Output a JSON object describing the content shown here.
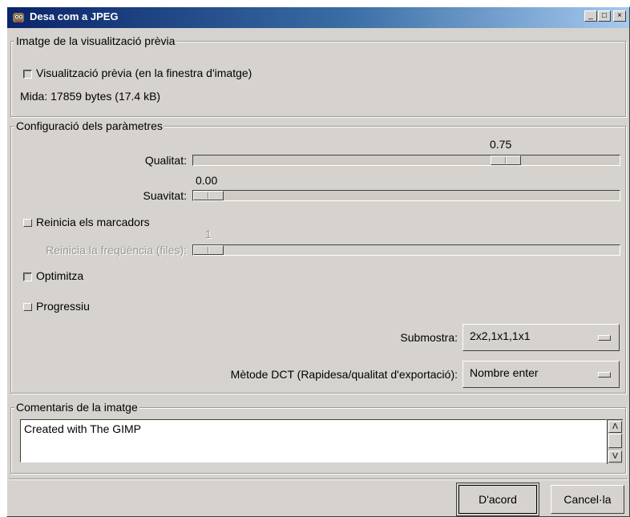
{
  "window": {
    "title": "Desa com a JPEG",
    "controls": {
      "minimize": "_",
      "maximize": "□",
      "close": "×"
    }
  },
  "preview_frame": {
    "title": "Imatge de la visualització prèvia",
    "preview_checkbox_label": "Visualització prèvia (en la finestra d'imatge)",
    "preview_checked": false,
    "size_text": "Mida: 17859 bytes (17.4 kB)"
  },
  "params_frame": {
    "title": "Configuració dels paràmetres",
    "quality": {
      "label": "Qualitat:",
      "value": "0.75"
    },
    "smoothing": {
      "label": "Suavitat:",
      "value": "0.00"
    },
    "restart_markers": {
      "label": "Reinicia els marcadors",
      "checked": false
    },
    "restart_frequency": {
      "label": "Reinicia la freqüència (files):",
      "value": "1",
      "disabled": true
    },
    "optimize": {
      "label": "Optimitza",
      "checked": false
    },
    "progressive": {
      "label": "Progressiu",
      "checked": false
    },
    "subsampling": {
      "label": "Submostra:",
      "selected": "2x2,1x1,1x1"
    },
    "dct_method": {
      "label": "Mètode DCT (Rapidesa/qualitat d'exportació):",
      "selected": "Nombre enter"
    }
  },
  "comment_frame": {
    "title": "Comentaris de la imatge",
    "text": "Created with The GIMP",
    "scroll_up": "Λ",
    "scroll_down": "V"
  },
  "buttons": {
    "ok": "D'acord",
    "cancel": "Cancel·la"
  }
}
